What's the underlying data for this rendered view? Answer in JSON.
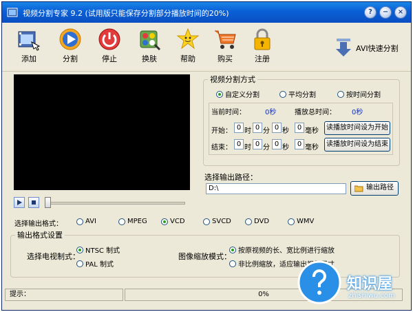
{
  "window": {
    "title": "视频分割专家 9.2 (试用版只能保存分割部分播放时间的20%)"
  },
  "toolbar": {
    "add": "添加",
    "split": "分割",
    "stop": "停止",
    "skin": "换肤",
    "help": "帮助",
    "buy": "购买",
    "register": "注册",
    "avi_split": "AVI快速分割"
  },
  "split_mode": {
    "legend": "视频分割方式",
    "options": [
      "自定义分割",
      "平均分割",
      "按时间分割"
    ],
    "selected": "自定义分割",
    "current_time_label": "当前时间：",
    "current_time_value": "0秒",
    "total_time_label": "播放总时间：",
    "total_time_value": "0秒",
    "start_label": "开始：",
    "end_label": "结束：",
    "hour_unit": "时",
    "minute_unit": "分",
    "second_unit": "秒",
    "ms_unit": "毫秒",
    "start_values": [
      "0",
      "0",
      "0",
      "0"
    ],
    "end_values": [
      "0",
      "0",
      "0",
      "0"
    ],
    "set_start_button": "读播放时间设为开始",
    "set_end_button": "读播放时间设为结束"
  },
  "output_path": {
    "label": "选择输出路径：",
    "value": "D:\\",
    "button": "输出路径"
  },
  "output_format": {
    "label": "选择输出格式：",
    "options": [
      "AVI",
      "MPEG",
      "VCD",
      "SVCD",
      "DVD",
      "WMV"
    ],
    "selected": "VCD"
  },
  "format_settings": {
    "legend": "输出格式设置",
    "tv_label": "选择电视制式：",
    "tv_options": [
      "NTSC 制式",
      "PAL  制式"
    ],
    "tv_selected": "NTSC 制式",
    "scale_label": "图像缩放模式：",
    "scale_options": [
      "按原视频的长、宽比例进行缩放",
      "非比例缩放，适应输出视频尺寸"
    ],
    "scale_selected": "按原视频的长、宽比例进行缩放"
  },
  "status": {
    "hint_label": "提示：",
    "hint_text": "",
    "progress": "0%"
  },
  "watermark": {
    "brand": "知识屋",
    "domain": "zhishiwu.com"
  },
  "colors": {
    "title_bar": "#0a5fd6",
    "window_bg": "#ece9d8",
    "radio_dot": "#26a317",
    "watermark_blue": "#2a8fe6"
  }
}
